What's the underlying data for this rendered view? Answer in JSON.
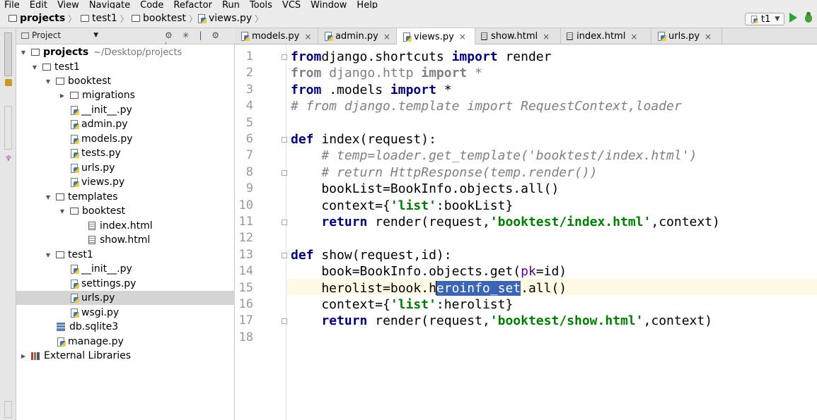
{
  "menu": [
    "File",
    "Edit",
    "View",
    "Navigate",
    "Code",
    "Refactor",
    "Run",
    "Tools",
    "VCS",
    "Window",
    "Help"
  ],
  "breadcrumb": {
    "project": "projects",
    "app": "test1",
    "package": "booktest",
    "file": "views.py"
  },
  "run_config": "t1",
  "project_panel": {
    "title": "Project",
    "tools": "⚙ ✳ | ⚙ ⊢"
  },
  "tree": [
    {
      "label": "projects",
      "path": "~/Desktop/projects"
    },
    {
      "label": "test1"
    },
    {
      "label": "booktest"
    },
    {
      "label": "migrations"
    },
    {
      "label": "__init__.py"
    },
    {
      "label": "admin.py"
    },
    {
      "label": "models.py"
    },
    {
      "label": "tests.py"
    },
    {
      "label": "urls.py"
    },
    {
      "label": "views.py"
    },
    {
      "label": "templates"
    },
    {
      "label": "booktest"
    },
    {
      "label": "index.html"
    },
    {
      "label": "show.html"
    },
    {
      "label": "test1"
    },
    {
      "label": "__init__.py"
    },
    {
      "label": "settings.py"
    },
    {
      "label": "urls.py"
    },
    {
      "label": "wsgi.py"
    },
    {
      "label": "db.sqlite3"
    },
    {
      "label": "manage.py"
    },
    {
      "label": "External Libraries"
    }
  ],
  "tabs": [
    "models.py",
    "admin.py",
    "views.py",
    "show.html",
    "index.html",
    "urls.py"
  ],
  "code_lines": [
    {
      "n": "1",
      "parts": [
        [
          "kw",
          "from"
        ],
        [
          "",
          "django.shortcuts "
        ],
        [
          "kw",
          "import"
        ],
        [
          "",
          " render"
        ]
      ]
    },
    {
      "n": "2",
      "parts": [
        [
          "kwg",
          "from"
        ],
        [
          "gr",
          " django.http "
        ],
        [
          "kwg",
          "import"
        ],
        [
          "gr",
          " *"
        ]
      ]
    },
    {
      "n": "3",
      "parts": [
        [
          "kw",
          "from"
        ],
        [
          "",
          " .models "
        ],
        [
          "kw",
          "import"
        ],
        [
          "",
          " *"
        ]
      ]
    },
    {
      "n": "4",
      "parts": [
        [
          "cm",
          "# from django.template import RequestContext,loader"
        ]
      ]
    },
    {
      "n": "5",
      "parts": []
    },
    {
      "n": "6",
      "parts": [
        [
          "kw",
          "def"
        ],
        [
          "",
          " index(request):"
        ]
      ]
    },
    {
      "n": "7",
      "parts": [
        [
          "",
          "    "
        ],
        [
          "cm",
          "# temp=loader.get_template('booktest/index.html')"
        ]
      ]
    },
    {
      "n": "8",
      "parts": [
        [
          "",
          "    "
        ],
        [
          "cm",
          "# return HttpResponse(temp.render())"
        ]
      ]
    },
    {
      "n": "9",
      "parts": [
        [
          "",
          "    bookList=BookInfo.objects.all()"
        ]
      ]
    },
    {
      "n": "10",
      "parts": [
        [
          "",
          "    context={"
        ],
        [
          "st",
          "'list'"
        ],
        [
          "",
          ":bookList}"
        ]
      ]
    },
    {
      "n": "11",
      "parts": [
        [
          "",
          "    "
        ],
        [
          "kw",
          "return"
        ],
        [
          "",
          " render(request,"
        ],
        [
          "st",
          "'booktest/index.html'"
        ],
        [
          "",
          ",context)"
        ]
      ]
    },
    {
      "n": "12",
      "parts": []
    },
    {
      "n": "13",
      "parts": [
        [
          "kw",
          "def"
        ],
        [
          "",
          " show(request,id):"
        ]
      ]
    },
    {
      "n": "14",
      "parts": [
        [
          "",
          "    book=BookInfo.objects.get("
        ],
        [
          "pm",
          "pk"
        ],
        [
          "",
          "=id)"
        ]
      ]
    },
    {
      "n": "15",
      "parts": [
        [
          "",
          "    herolist=book.h"
        ],
        [
          "caret",
          ""
        ],
        [
          "selx",
          "eroinfo_set"
        ],
        [
          "",
          ".all()"
        ]
      ]
    },
    {
      "n": "16",
      "parts": [
        [
          "",
          "    context={"
        ],
        [
          "st",
          "'list'"
        ],
        [
          "",
          ":herolist}"
        ]
      ]
    },
    {
      "n": "17",
      "parts": [
        [
          "",
          "    "
        ],
        [
          "kw",
          "return"
        ],
        [
          "",
          " render(request,"
        ],
        [
          "st",
          "'booktest/show.html'"
        ],
        [
          "",
          ",context)"
        ]
      ]
    },
    {
      "n": "18",
      "parts": []
    }
  ]
}
